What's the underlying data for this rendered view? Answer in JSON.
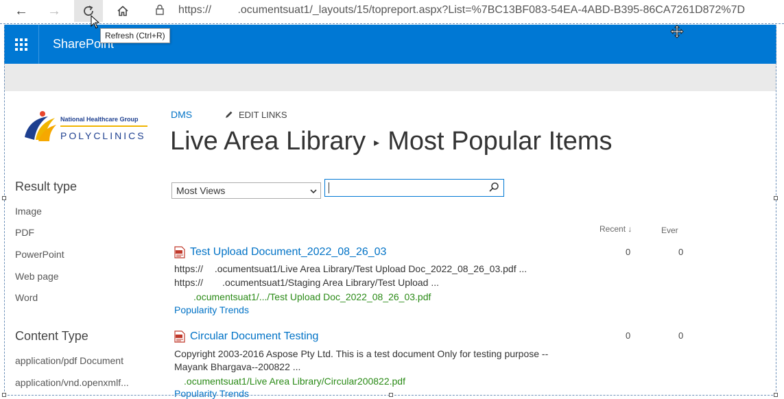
{
  "browser": {
    "url": "https://            .ocumentsuat1/_layouts/15/topreport.aspx?List=%7BC13BF083-54EA-4ABD-B395-86CA7261D872%7D",
    "tooltip": "Refresh (Ctrl+R)"
  },
  "suite": {
    "title": "SharePoint"
  },
  "logo": {
    "line1": "National Healthcare Group",
    "line2": "POLYCLINICS"
  },
  "header": {
    "crumb": "DMS",
    "edit_links": "EDIT LINKS",
    "title_library": "Live Area Library",
    "title_separator": "▸",
    "title_page": "Most Popular Items"
  },
  "refiners": {
    "result_type": {
      "heading": "Result type",
      "items": [
        "Image",
        "PDF",
        "PowerPoint",
        "Web page",
        "Word"
      ]
    },
    "content_type": {
      "heading": "Content Type",
      "items": [
        "application/pdf Document",
        "application/vnd.openxmlf..."
      ]
    }
  },
  "controls": {
    "sort_selected": "Most Views",
    "search_value": ""
  },
  "columns": {
    "recent": "Recent ↓",
    "ever": "Ever"
  },
  "results": [
    {
      "title": "Test Upload Document_2022_08_26_03",
      "line1": "https://      .ocumentsuat1/Live Area Library/Test Upload Doc_2022_08_26_03.pdf ...",
      "line2": "https://          .ocumentsuat1/Staging Area Library/Test Upload ...",
      "path": "          .ocumentsuat1/.../Test Upload Doc_2022_08_26_03.pdf",
      "trend": "Popularity Trends",
      "recent": "0",
      "ever": "0"
    },
    {
      "title": "Circular Document Testing",
      "line1": "Copyright 2003-2016 Aspose Pty Ltd. This is a test document Only for testing purpose --",
      "line2": "Mayank Bhargava--200822 ...",
      "path": "     .ocumentsuat1/Live Area Library/Circular200822.pdf",
      "trend": "Popularity Trends",
      "recent": "0",
      "ever": "0"
    }
  ],
  "colors": {
    "accent": "#0078d4",
    "link": "#0072c6",
    "path": "#2a8a16"
  }
}
